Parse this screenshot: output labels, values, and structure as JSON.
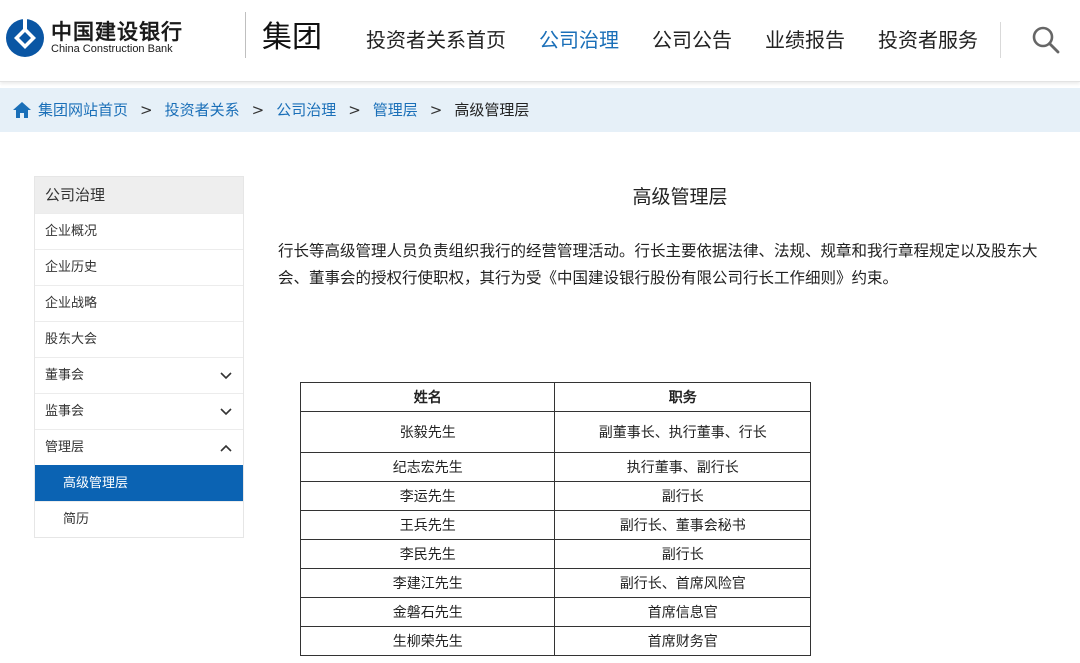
{
  "header": {
    "logo_cn": "中国建设银行",
    "logo_en": "China Construction Bank",
    "group_label": "集团",
    "nav": [
      {
        "label": "投资者关系首页",
        "active": false
      },
      {
        "label": "公司治理",
        "active": true
      },
      {
        "label": "公司公告",
        "active": false
      },
      {
        "label": "业绩报告",
        "active": false
      },
      {
        "label": "投资者服务",
        "active": false
      }
    ],
    "search_icon": "search-icon"
  },
  "breadcrumb": {
    "items": [
      "集团网站首页",
      "投资者关系",
      "公司治理",
      "管理层"
    ],
    "separator": ">",
    "current": "高级管理层"
  },
  "sidebar": {
    "title": "公司治理",
    "items": [
      {
        "label": "企业概况"
      },
      {
        "label": "企业历史"
      },
      {
        "label": "企业战略"
      },
      {
        "label": "股东大会"
      },
      {
        "label": "董事会",
        "chevron": "down"
      },
      {
        "label": "监事会",
        "chevron": "down"
      },
      {
        "label": "管理层",
        "chevron": "up"
      }
    ],
    "subitems": [
      {
        "label": "高级管理层",
        "active": true
      },
      {
        "label": "简历",
        "active": false
      }
    ]
  },
  "main": {
    "title": "高级管理层",
    "intro": "行长等高级管理人员负责组织我行的经营管理活动。行长主要依据法律、法规、规章和我行章程规定以及股东大会、董事会的授权行使职权，其行为受《中国建设银行股份有限公司行长工作细则》约束。",
    "table": {
      "headers": [
        "姓名",
        "职务"
      ],
      "rows": [
        [
          "张毅先生",
          "副董事长、执行董事、行长"
        ],
        [
          "纪志宏先生",
          "执行董事、副行长"
        ],
        [
          "李运先生",
          "副行长"
        ],
        [
          "王兵先生",
          "副行长、董事会秘书"
        ],
        [
          "李民先生",
          "副行长"
        ],
        [
          "李建江先生",
          "副行长、首席风险官"
        ],
        [
          "金磐石先生",
          "首席信息官"
        ],
        [
          "生柳荣先生",
          "首席财务官"
        ]
      ]
    }
  },
  "colors": {
    "accent": "#1a6fb8",
    "sidebar_active": "#0b63b3",
    "breadcrumb_bg": "#e6f0f8",
    "logo_blue": "#0a56a4"
  }
}
